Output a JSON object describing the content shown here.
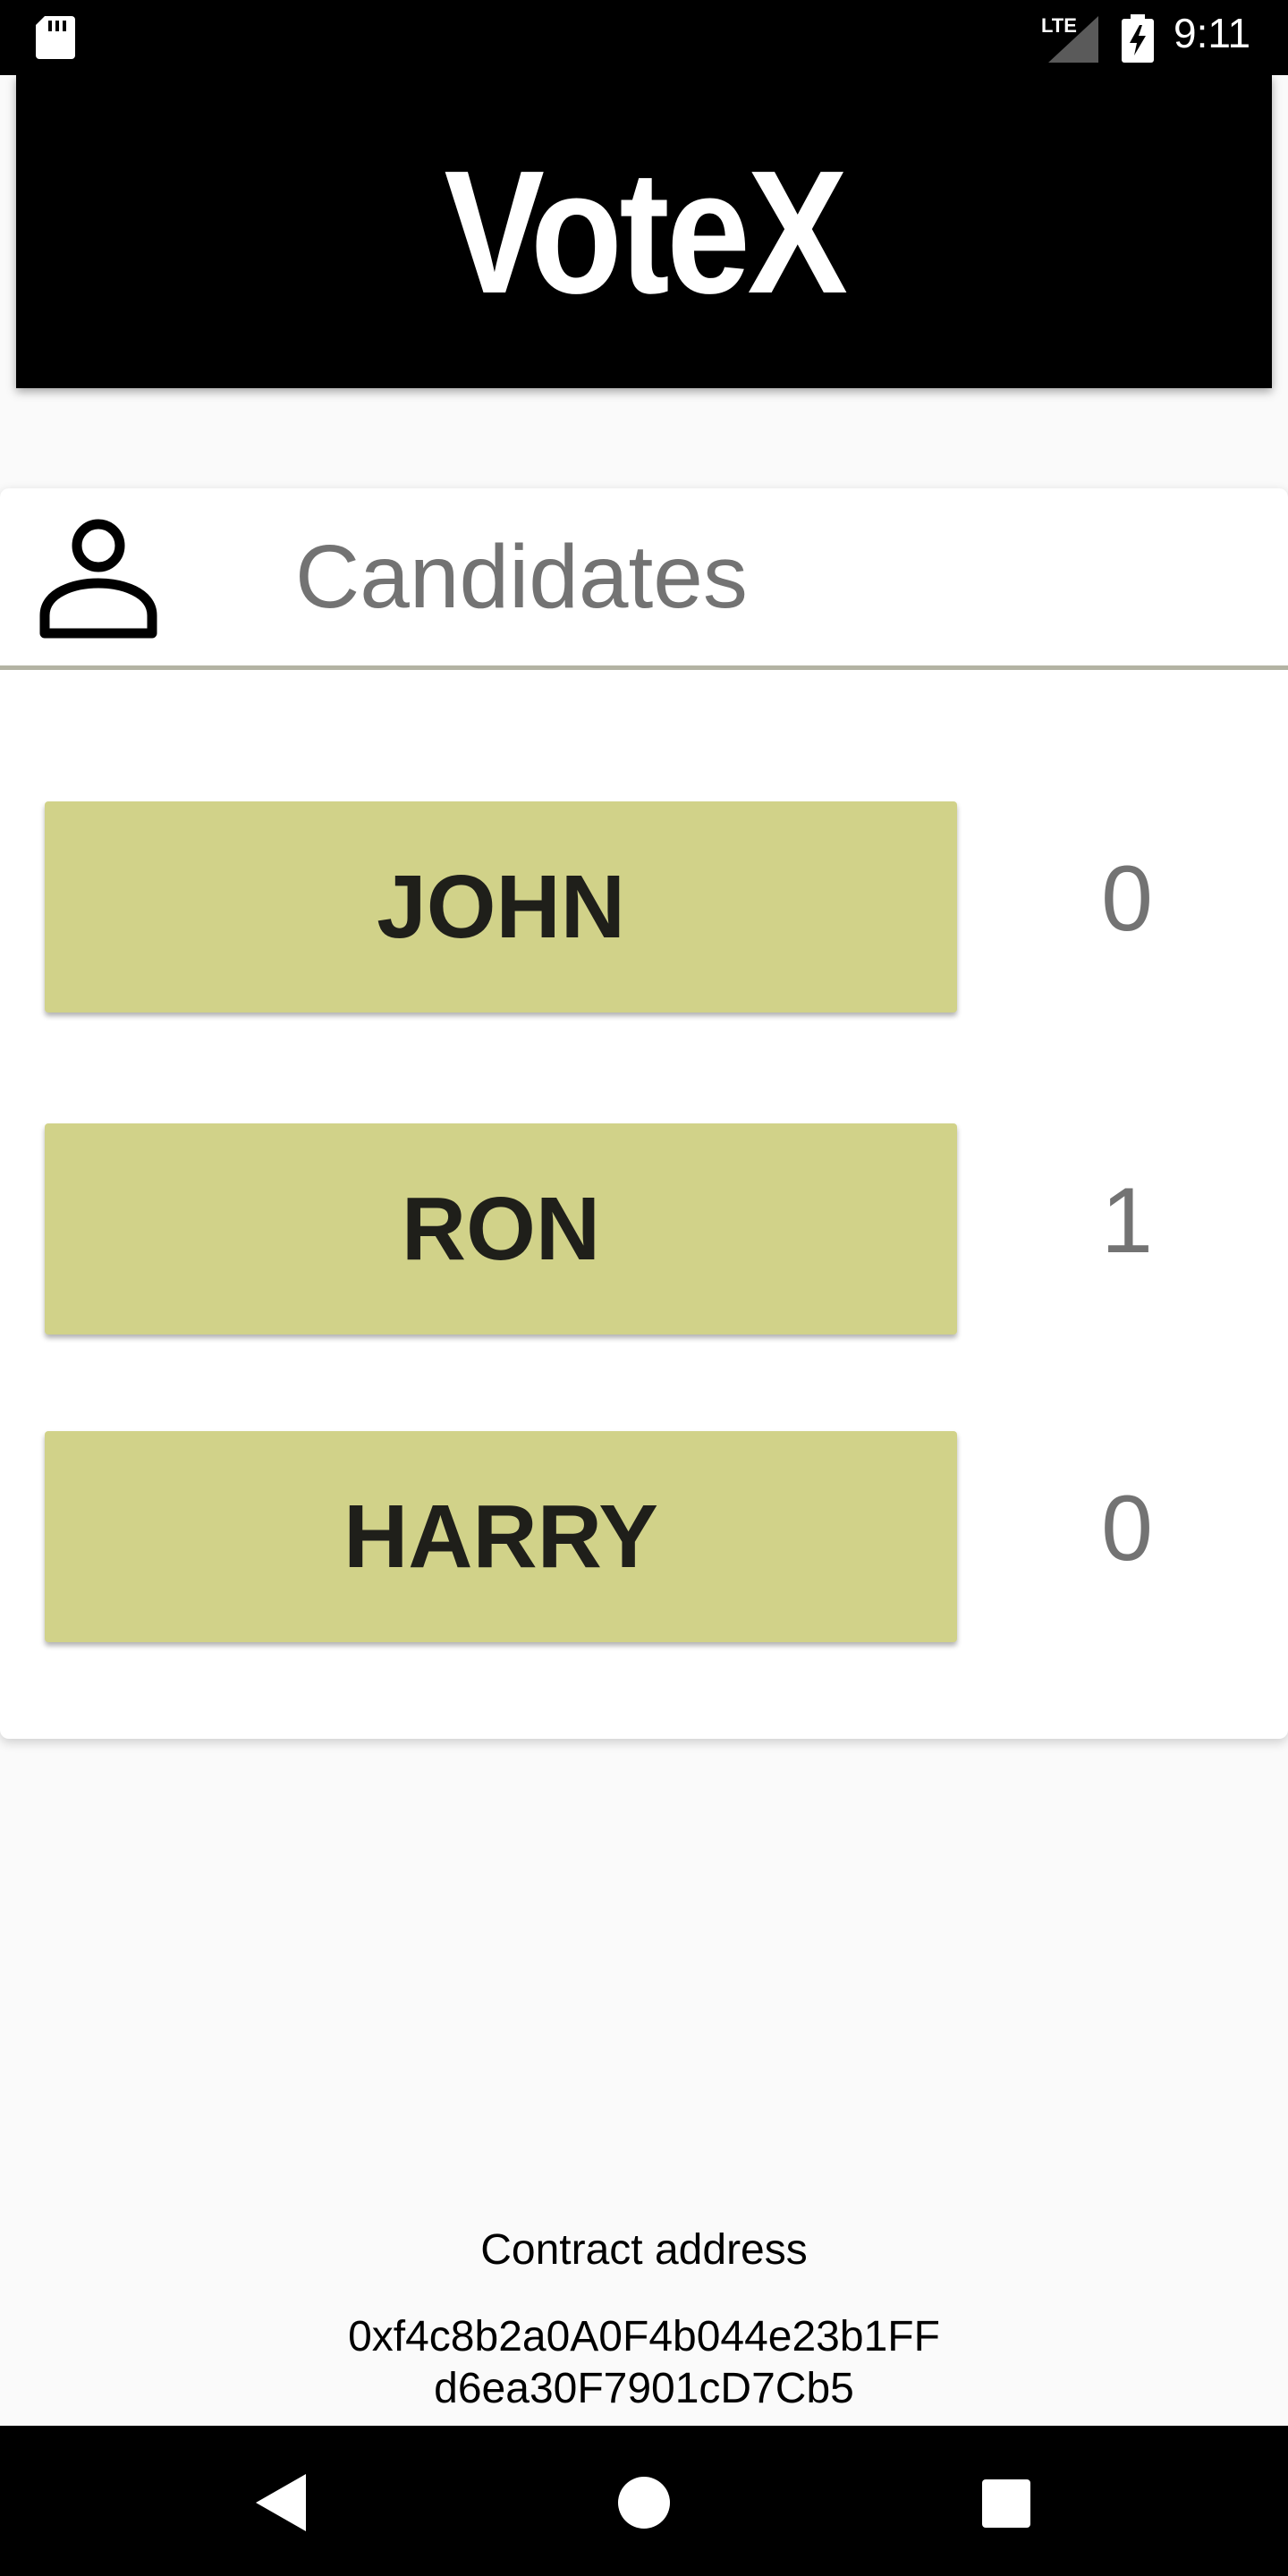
{
  "status_bar": {
    "network_label": "LTE",
    "time": "9:11",
    "icons": [
      "sd-card-icon",
      "signal-icon",
      "battery-charging-icon"
    ]
  },
  "app": {
    "title": "VoteX"
  },
  "candidates_card": {
    "title": "Candidates",
    "icon": "person-icon",
    "candidates": [
      {
        "name": "JOHN",
        "votes": "0"
      },
      {
        "name": "RON",
        "votes": "1"
      },
      {
        "name": "HARRY",
        "votes": "0"
      }
    ]
  },
  "contract": {
    "label": "Contract address",
    "address_line1": "0xf4c8b2a0A0F4b044e23b1FF",
    "address_line2": "d6ea30F7901cD7Cb5"
  },
  "nav_bar": {
    "icons": [
      "back-icon",
      "home-icon",
      "recent-apps-icon"
    ]
  },
  "colors": {
    "button_bg": "#d1d289",
    "header_bg": "#000000",
    "count_text": "#737373",
    "divider": "#b3b3a3"
  }
}
